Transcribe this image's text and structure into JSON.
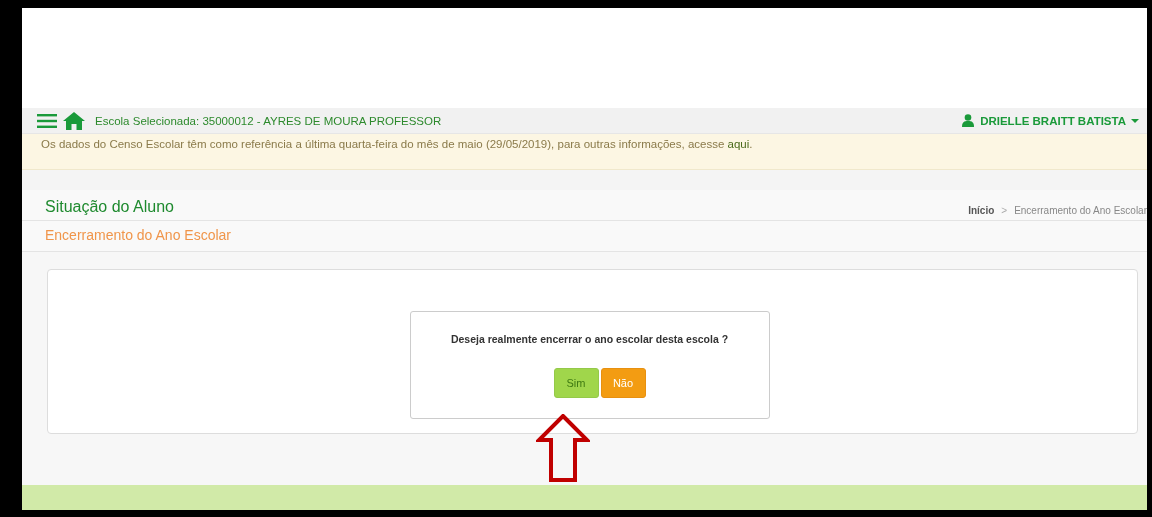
{
  "navbar": {
    "school": "Escola Selecionada: 35000012 - AYRES DE MOURA PROFESSOR",
    "user": "DRIELLE BRAITT BATISTA"
  },
  "notice": {
    "text": "Os dados do Censo Escolar têm como referência a última quarta-feira do mês de maio (29/05/2019), para outras informações, acesse ",
    "link": "aqui",
    "end": "."
  },
  "page": {
    "title": "Situação do Aluno",
    "subtitle": "Encerramento do Ano Escolar"
  },
  "breadcrumb": [
    {
      "label": "Início",
      "kind": "link"
    },
    {
      "label": ">",
      "kind": "separator"
    },
    {
      "label": "Encerramento do Ano Escolar",
      "kind": "current"
    }
  ],
  "dialog": {
    "message": "Deseja realmente encerrar o ano escolar desta escola ?",
    "buttons": [
      {
        "label": "Sim",
        "kind": "confirm"
      },
      {
        "label": "Não",
        "kind": "cancel"
      }
    ]
  }
}
